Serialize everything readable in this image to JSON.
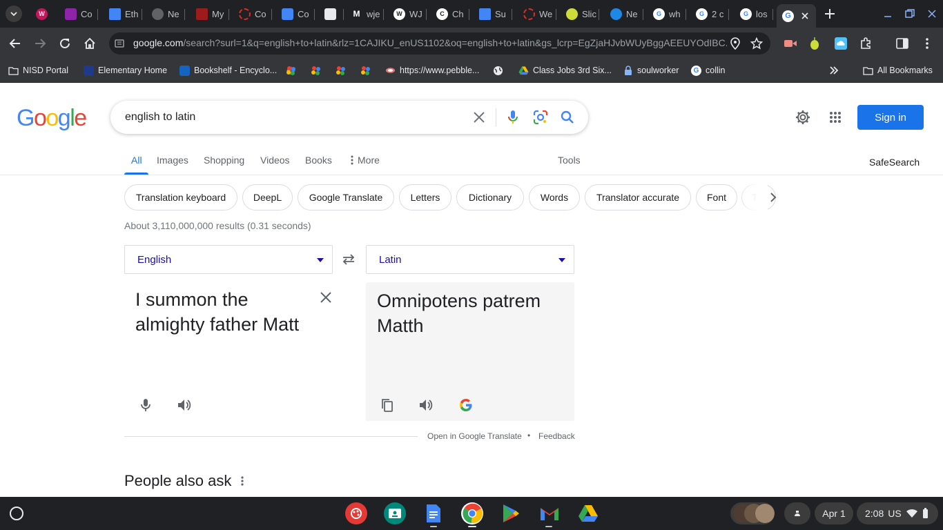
{
  "browser": {
    "tabs": [
      {
        "label": "",
        "fav_text": "W",
        "fav_color": "#c2185b"
      },
      {
        "label": "Co",
        "fav_text": "",
        "fav_color": "#8e24aa"
      },
      {
        "label": "Eth",
        "fav_text": "",
        "fav_color": "#4285f4"
      },
      {
        "label": "Ne",
        "fav_text": "",
        "fav_color": "#5f6368"
      },
      {
        "label": "My",
        "fav_text": "",
        "fav_color": "#9c1b1b"
      },
      {
        "label": "Co",
        "fav_text": "",
        "fav_color": "#d93025"
      },
      {
        "label": "Co",
        "fav_text": "",
        "fav_color": "#4285f4"
      },
      {
        "label": "",
        "fav_text": "",
        "fav_color": "#e8eaed"
      },
      {
        "label": "wje",
        "fav_text": "M",
        "fav_color": "#202124"
      },
      {
        "label": "WJ",
        "fav_text": "W",
        "fav_color": "#ffffff"
      },
      {
        "label": "Ch",
        "fav_text": "C",
        "fav_color": "#ffffff"
      },
      {
        "label": "Su",
        "fav_text": "",
        "fav_color": "#4285f4"
      },
      {
        "label": "We",
        "fav_text": "",
        "fav_color": "#d93025"
      },
      {
        "label": "Slic",
        "fav_text": "",
        "fav_color": "#cddc39"
      },
      {
        "label": "Ne",
        "fav_text": "",
        "fav_color": "#1e88e5"
      },
      {
        "label": "wh",
        "fav_text": "G",
        "fav_color": "#ffffff"
      },
      {
        "label": "2 c",
        "fav_text": "G",
        "fav_color": "#ffffff"
      },
      {
        "label": "los",
        "fav_text": "G",
        "fav_color": "#ffffff"
      }
    ],
    "url_host": "google.com",
    "url_path": "/search?surl=1&q=english+to+latin&rlz=1CAJIKU_enUS1102&oq=english+to+latin&gs_lcrp=EgZjaHJvbWUyBggAEEUYOdIBC...",
    "bookmarks": [
      {
        "label": "NISD Portal",
        "icon": "folder-icon"
      },
      {
        "label": "Elementary Home",
        "icon": "school-icon"
      },
      {
        "label": "Bookshelf - Encyclo...",
        "icon": "book-icon"
      },
      {
        "label": "https://www.pebble...",
        "icon": "pebble-icon"
      },
      {
        "label": "Class Jobs 3rd Six...",
        "icon": "drive-icon"
      },
      {
        "label": "soulworker",
        "icon": "lock-icon"
      },
      {
        "label": "collin",
        "icon": "google-icon"
      }
    ],
    "all_bookmarks": "All Bookmarks"
  },
  "search": {
    "logo": "Google",
    "query": "english to latin",
    "sign_in": "Sign in",
    "tabs": [
      "All",
      "Images",
      "Shopping",
      "Videos",
      "Books",
      "More"
    ],
    "tools": "Tools",
    "safesearch": "SafeSearch",
    "chips": [
      "Translation keyboard",
      "DeepL",
      "Google Translate",
      "Letters",
      "Dictionary",
      "Words",
      "Translator accurate",
      "Font",
      "T"
    ],
    "stats": "About 3,110,000,000 results (0.31 seconds)"
  },
  "translator": {
    "source_lang": "English",
    "target_lang": "Latin",
    "source_text": "I summon the almighty father Matt",
    "target_text": "Omnipotens patrem Matth",
    "open_link": "Open in Google Translate",
    "separator": "•",
    "feedback": "Feedback"
  },
  "people_also_ask": "People also ask",
  "shelf": {
    "date": "Apr 1",
    "time": "2:08",
    "locale": "US"
  },
  "colors": {
    "accent": "#1a73e8",
    "link": "#1a0dab",
    "chrome_dark": "#202124",
    "chrome_toolbar": "#35363a"
  }
}
